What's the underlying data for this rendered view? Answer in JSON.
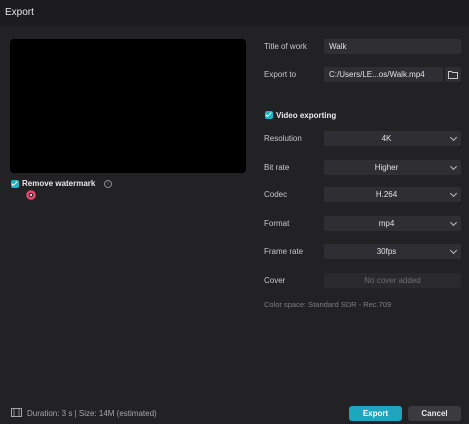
{
  "window": {
    "title": "Export"
  },
  "preview": {
    "remove_watermark_label": "Remove watermark",
    "remove_watermark_checked": true
  },
  "form": {
    "title_of_work_label": "Title of work",
    "title_of_work_value": "Walk",
    "export_to_label": "Export to",
    "export_to_value": "C:/Users/LE...os/Walk.mp4",
    "video_exporting_label": "Video exporting",
    "video_exporting_checked": true,
    "resolution_label": "Resolution",
    "resolution_value": "4K",
    "bitrate_label": "Bit rate",
    "bitrate_value": "Higher",
    "codec_label": "Codec",
    "codec_value": "H.264",
    "format_label": "Format",
    "format_value": "mp4",
    "framerate_label": "Frame rate",
    "framerate_value": "30fps",
    "cover_label": "Cover",
    "cover_value": "No cover added",
    "color_space": "Color space:  Standard SDR - Rec.709"
  },
  "footer": {
    "info": "Duration: 3 s | Size: 14M (estimated)",
    "export_label": "Export",
    "cancel_label": "Cancel"
  },
  "icons": {
    "folder": "folder-icon",
    "info": "info-icon",
    "film": "film-icon",
    "chevron": "chevron-down-icon",
    "donut": "donut-icon"
  },
  "colors": {
    "accent": "#1fa5bd",
    "background": "#222225",
    "field": "#2f2f33"
  }
}
